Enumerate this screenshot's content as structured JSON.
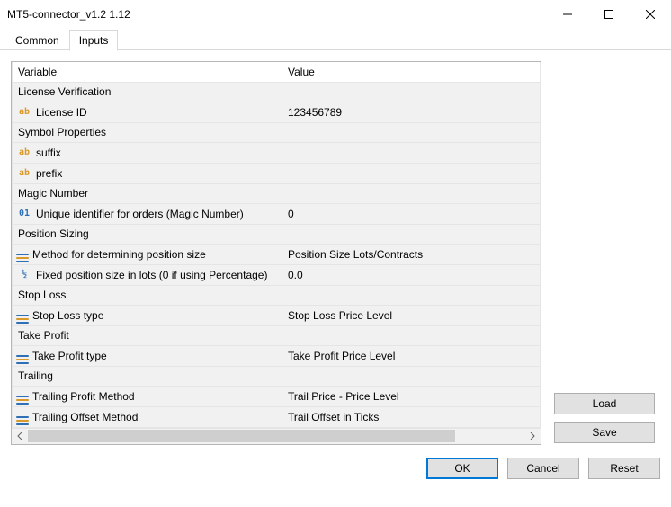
{
  "window": {
    "title": "MT5-connector_v1.2 1.12"
  },
  "tabs": {
    "common": "Common",
    "inputs": "Inputs",
    "active": "inputs"
  },
  "table": {
    "header_variable": "Variable",
    "header_value": "Value"
  },
  "rows": [
    {
      "kind": "section",
      "label": "License Verification"
    },
    {
      "kind": "param",
      "icon": "ab",
      "label": "License ID",
      "value": "123456789"
    },
    {
      "kind": "section",
      "label": "Symbol Properties"
    },
    {
      "kind": "param",
      "icon": "ab",
      "label": "suffix",
      "value": ""
    },
    {
      "kind": "param",
      "icon": "ab",
      "label": "prefix",
      "value": ""
    },
    {
      "kind": "section",
      "label": "Magic Number"
    },
    {
      "kind": "param",
      "icon": "01",
      "label": "Unique identifier for orders (Magic Number)",
      "value": "0"
    },
    {
      "kind": "section",
      "label": "Position Sizing"
    },
    {
      "kind": "param",
      "icon": "enum",
      "label": "Method for determining position size",
      "value": "Position Size Lots/Contracts"
    },
    {
      "kind": "param",
      "icon": "frac",
      "label": "Fixed position size in lots (0 if using Percentage)",
      "value": "0.0"
    },
    {
      "kind": "section",
      "label": "Stop Loss"
    },
    {
      "kind": "param",
      "icon": "enum",
      "label": "Stop Loss type",
      "value": "Stop Loss Price Level"
    },
    {
      "kind": "section",
      "label": "Take Profit"
    },
    {
      "kind": "param",
      "icon": "enum",
      "label": "Take Profit type",
      "value": "Take Profit Price Level"
    },
    {
      "kind": "section",
      "label": "Trailing"
    },
    {
      "kind": "param",
      "icon": "enum",
      "label": "Trailing Profit Method",
      "value": "Trail Price - Price Level"
    },
    {
      "kind": "param",
      "icon": "enum",
      "label": "Trailing Offset Method",
      "value": "Trail Offset in Ticks"
    }
  ],
  "side_buttons": {
    "load": "Load",
    "save": "Save"
  },
  "footer": {
    "ok": "OK",
    "cancel": "Cancel",
    "reset": "Reset"
  }
}
